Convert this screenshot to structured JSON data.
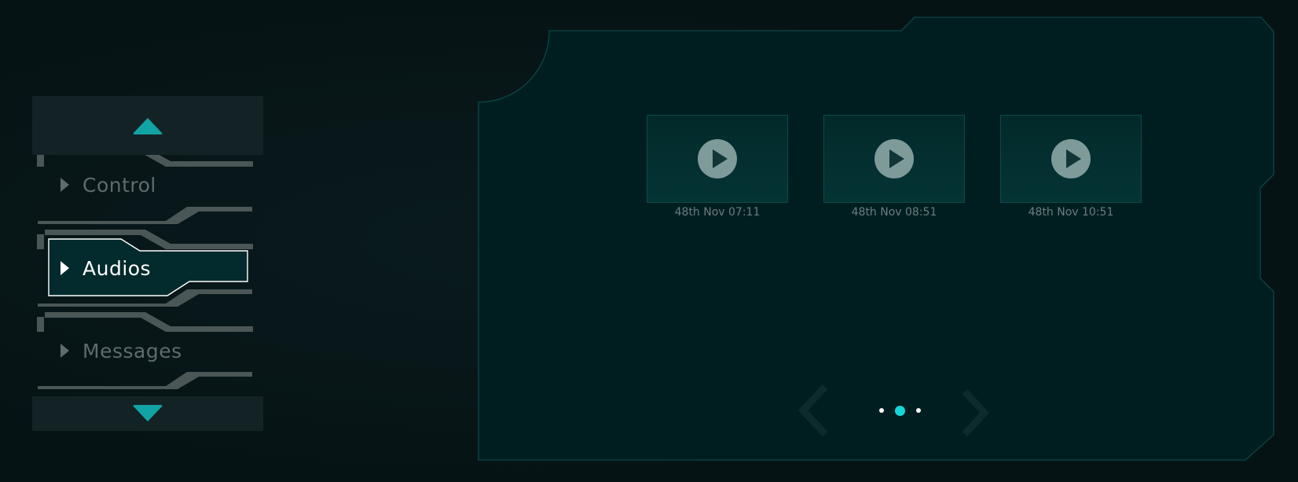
{
  "menu": {
    "scroll_up_icon": "chevron-up-icon",
    "scroll_down_icon": "chevron-down-icon",
    "items": [
      {
        "label": "Control",
        "active": false
      },
      {
        "label": "Audios",
        "active": true
      },
      {
        "label": "Messages",
        "active": false
      }
    ]
  },
  "gallery": {
    "items": [
      {
        "caption": "48th Nov 07:11",
        "icon": "play-icon"
      },
      {
        "caption": "48th Nov 08:51",
        "icon": "play-icon"
      },
      {
        "caption": "48th Nov 10:51",
        "icon": "play-icon"
      }
    ],
    "pager": {
      "pages": 3,
      "current": 2
    },
    "prev_icon": "chevron-left-icon",
    "next_icon": "chevron-right-icon"
  },
  "colors": {
    "accent": "#13d6d9",
    "scroll_arrow": "#12a3a4",
    "panel_border": "#0c4a4a",
    "panel_fill": "#001e20",
    "menu_inactive": "#5f6b6c",
    "menu_active": "#ffffff"
  }
}
